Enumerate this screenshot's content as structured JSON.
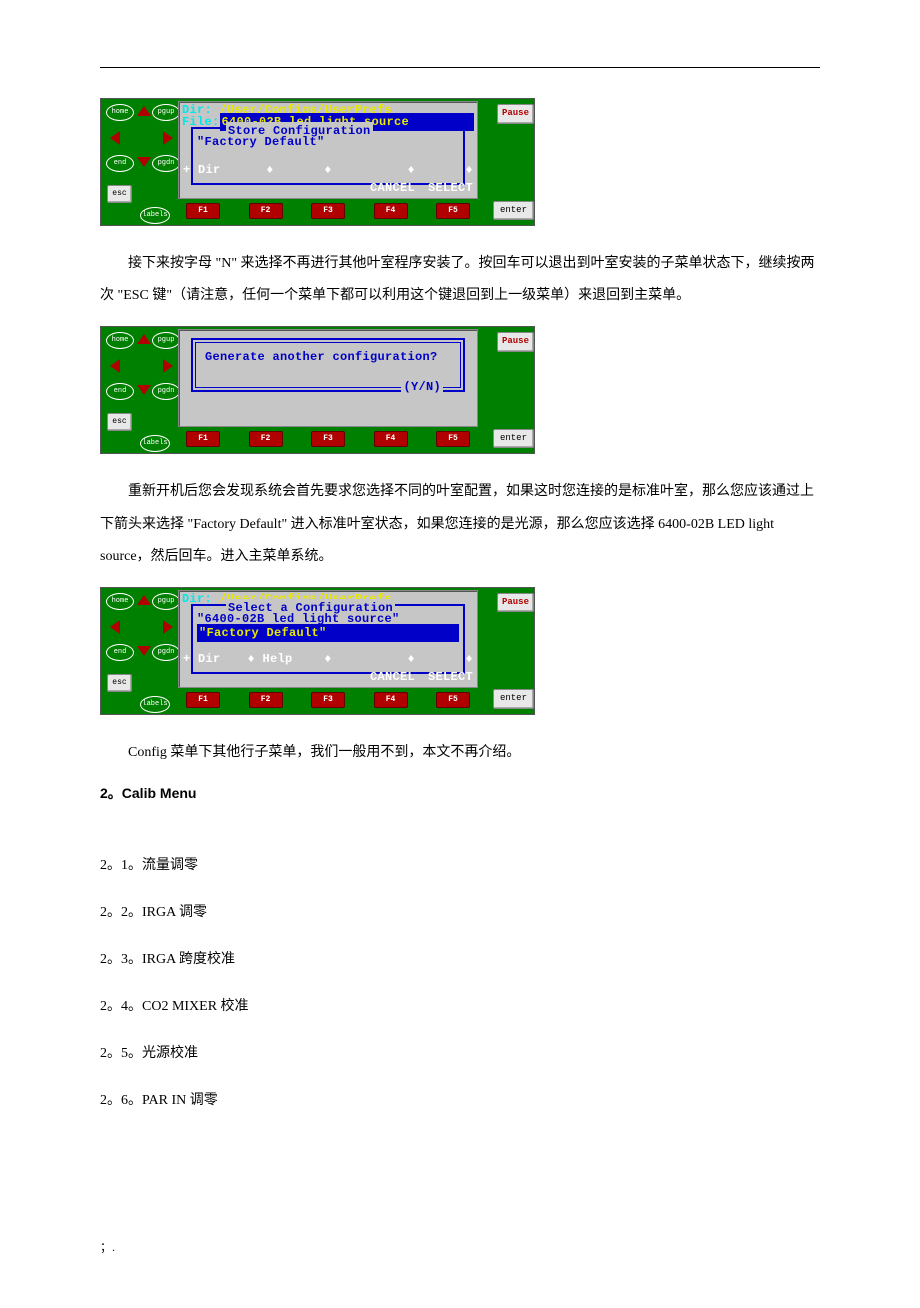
{
  "nav": {
    "home": "home",
    "pgup": "pgup",
    "end": "end",
    "pgdn": "pgdn",
    "esc": "esc",
    "labels": "labels"
  },
  "right": {
    "pause": "Pause",
    "enter": "enter"
  },
  "fkeys": [
    "F1",
    "F2",
    "F3",
    "F4",
    "F5"
  ],
  "screen1": {
    "dir_label": "Dir:",
    "dir_path": " /User/Configs/UserPrefs",
    "file_label": "File:",
    "file_name": "6400-02B led light source",
    "box_title": "Store Configuration",
    "item": "\"Factory Default\"",
    "soft_dir": "+ Dir",
    "soft_b": "♦",
    "soft_c": "♦",
    "soft_cancel": "♦ CANCEL",
    "soft_select": "♦ SELECT"
  },
  "para1": "接下来按字母 \"N\" 来选择不再进行其他叶室程序安装了。按回车可以退出到叶室安装的子菜单状态下，继续按两次 \"ESC 键\"（请注意，任何一个菜单下都可以利用这个键退回到上一级菜单）来退回到主菜单。",
  "screen2": {
    "question": "Generate another configuration?",
    "yn": "(Y/N)"
  },
  "para2": "重新开机后您会发现系统会首先要求您选择不同的叶室配置，如果这时您连接的是标准叶室，那么您应该通过上下箭头来选择 \"Factory Default\" 进入标准叶室状态，如果您连接的是光源，那么您应该选择 6400-02B LED light source，然后回车。进入主菜单系统。",
  "screen3": {
    "dir_label": "Dir:",
    "dir_path": " /User/Configs/UserPrefs",
    "box_title": "Select a Configuration",
    "item1": "\"6400-02B led light source\"",
    "item2": "\"Factory Default\"",
    "soft_dir": "+ Dir",
    "soft_help": "♦ Help",
    "soft_c": "♦",
    "soft_cancel": "♦ CANCEL",
    "soft_select": "♦ SELECT"
  },
  "para3": "Config 菜单下其他行子菜单，我们一般用不到，本文不再介绍。",
  "heading_calib": "2。Calib Menu",
  "list": {
    "i1": "2。1。流量调零",
    "i2": "2。2。IRGA 调零",
    "i3": "2。3。IRGA 跨度校准",
    "i4": "2。4。CO2 MIXER  校准",
    "i5": "2。5。光源校准",
    "i6": "2。6。PAR IN 调零"
  },
  "footer": "；."
}
